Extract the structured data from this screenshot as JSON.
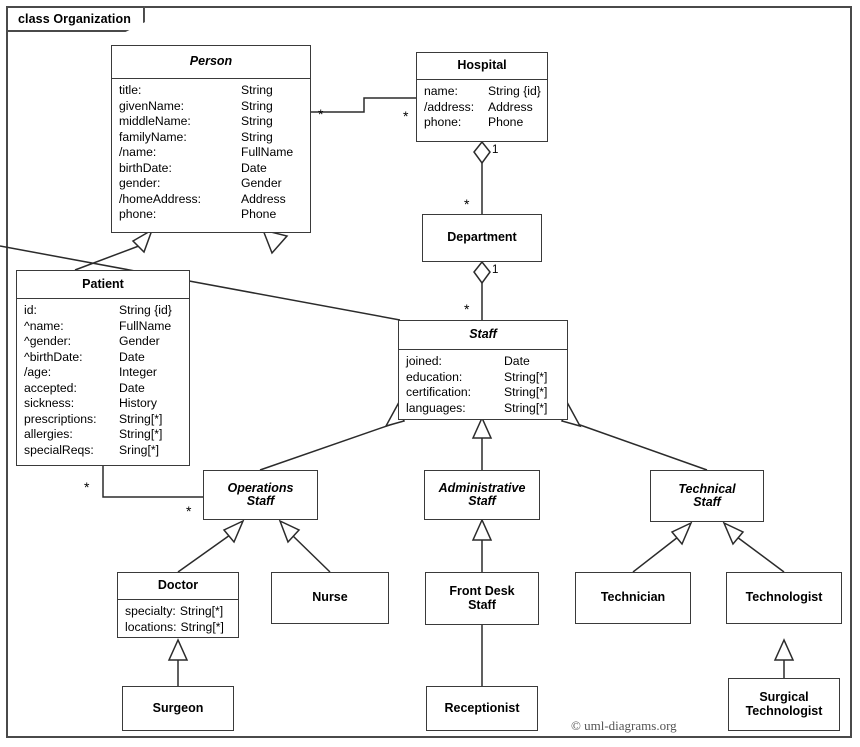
{
  "frame": {
    "label": "class Organization"
  },
  "credit": {
    "text": "© uml-diagrams.org"
  },
  "classes": {
    "person": {
      "name": "Person",
      "abstract": true,
      "attributes": [
        {
          "name": "title:",
          "type": "String"
        },
        {
          "name": "givenName:",
          "type": "String"
        },
        {
          "name": "middleName:",
          "type": "String"
        },
        {
          "name": "familyName:",
          "type": "String"
        },
        {
          "name": "/name:",
          "type": "FullName"
        },
        {
          "name": "birthDate:",
          "type": "Date"
        },
        {
          "name": "gender:",
          "type": "Gender"
        },
        {
          "name": "/homeAddress:",
          "type": "Address"
        },
        {
          "name": "phone:",
          "type": "Phone"
        }
      ]
    },
    "hospital": {
      "name": "Hospital",
      "abstract": false,
      "attributes": [
        {
          "name": "name:",
          "type": "String {id}"
        },
        {
          "name": "/address:",
          "type": "Address"
        },
        {
          "name": "phone:",
          "type": "Phone"
        }
      ]
    },
    "department": {
      "name": "Department",
      "abstract": false,
      "attributes": []
    },
    "patient": {
      "name": "Patient",
      "abstract": false,
      "attributes": [
        {
          "name": "id:",
          "type": "String {id}"
        },
        {
          "name": "^name:",
          "type": "FullName"
        },
        {
          "name": "^gender:",
          "type": "Gender"
        },
        {
          "name": "^birthDate:",
          "type": "Date"
        },
        {
          "name": "/age:",
          "type": "Integer"
        },
        {
          "name": "accepted:",
          "type": "Date"
        },
        {
          "name": "sickness:",
          "type": "History"
        },
        {
          "name": "prescriptions:",
          "type": "String[*]"
        },
        {
          "name": "allergies:",
          "type": "String[*]"
        },
        {
          "name": "specialReqs:",
          "type": "Sring[*]"
        }
      ]
    },
    "staff": {
      "name": "Staff",
      "abstract": true,
      "attributes": [
        {
          "name": "joined:",
          "type": "Date"
        },
        {
          "name": "education:",
          "type": "String[*]"
        },
        {
          "name": "certification:",
          "type": "String[*]"
        },
        {
          "name": "languages:",
          "type": "String[*]"
        }
      ]
    },
    "operations_staff": {
      "name": "Operations\nStaff",
      "abstract": true,
      "attributes": []
    },
    "administrative_staff": {
      "name": "Administrative\nStaff",
      "abstract": true,
      "attributes": []
    },
    "technical_staff": {
      "name": "Technical\nStaff",
      "abstract": true,
      "attributes": []
    },
    "doctor": {
      "name": "Doctor",
      "abstract": false,
      "attributes": [
        {
          "name": "specialty:",
          "type": "String[*]"
        },
        {
          "name": "locations:",
          "type": "String[*]"
        }
      ]
    },
    "nurse": {
      "name": "Nurse",
      "abstract": false,
      "attributes": []
    },
    "front_desk_staff": {
      "name": "Front Desk\nStaff",
      "abstract": false,
      "attributes": []
    },
    "technician": {
      "name": "Technician",
      "abstract": false,
      "attributes": []
    },
    "technologist": {
      "name": "Technologist",
      "abstract": false,
      "attributes": []
    },
    "surgeon": {
      "name": "Surgeon",
      "abstract": false,
      "attributes": []
    },
    "receptionist": {
      "name": "Receptionist",
      "abstract": false,
      "attributes": []
    },
    "surgical_technologist": {
      "name": "Surgical\nTechnologist",
      "abstract": false,
      "attributes": []
    }
  },
  "multiplicities": {
    "person_hospital_person_end": "*",
    "person_hospital_hospital_end": "*",
    "hospital_department_one": "1",
    "hospital_department_many": "*",
    "department_staff_one": "1",
    "department_staff_many": "*",
    "patient_operations_patient": "*",
    "patient_operations_staff": "*"
  },
  "relationships": [
    {
      "type": "generalization",
      "from": "patient",
      "to": "person"
    },
    {
      "type": "generalization",
      "from": "staff",
      "to": "person"
    },
    {
      "type": "generalization",
      "from": "operations_staff",
      "to": "staff"
    },
    {
      "type": "generalization",
      "from": "administrative_staff",
      "to": "staff"
    },
    {
      "type": "generalization",
      "from": "technical_staff",
      "to": "staff"
    },
    {
      "type": "generalization",
      "from": "doctor",
      "to": "operations_staff"
    },
    {
      "type": "generalization",
      "from": "nurse",
      "to": "operations_staff"
    },
    {
      "type": "generalization",
      "from": "front_desk_staff",
      "to": "administrative_staff"
    },
    {
      "type": "generalization",
      "from": "technician",
      "to": "technical_staff"
    },
    {
      "type": "generalization",
      "from": "technologist",
      "to": "technical_staff"
    },
    {
      "type": "generalization",
      "from": "surgeon",
      "to": "doctor"
    },
    {
      "type": "generalization",
      "from": "receptionist",
      "to": "front_desk_staff"
    },
    {
      "type": "generalization",
      "from": "surgical_technologist",
      "to": "technologist"
    },
    {
      "type": "association",
      "from": "person",
      "to": "hospital"
    },
    {
      "type": "association",
      "from": "patient",
      "to": "operations_staff"
    },
    {
      "type": "aggregation",
      "from": "hospital",
      "to": "department"
    },
    {
      "type": "aggregation",
      "from": "department",
      "to": "staff"
    }
  ]
}
